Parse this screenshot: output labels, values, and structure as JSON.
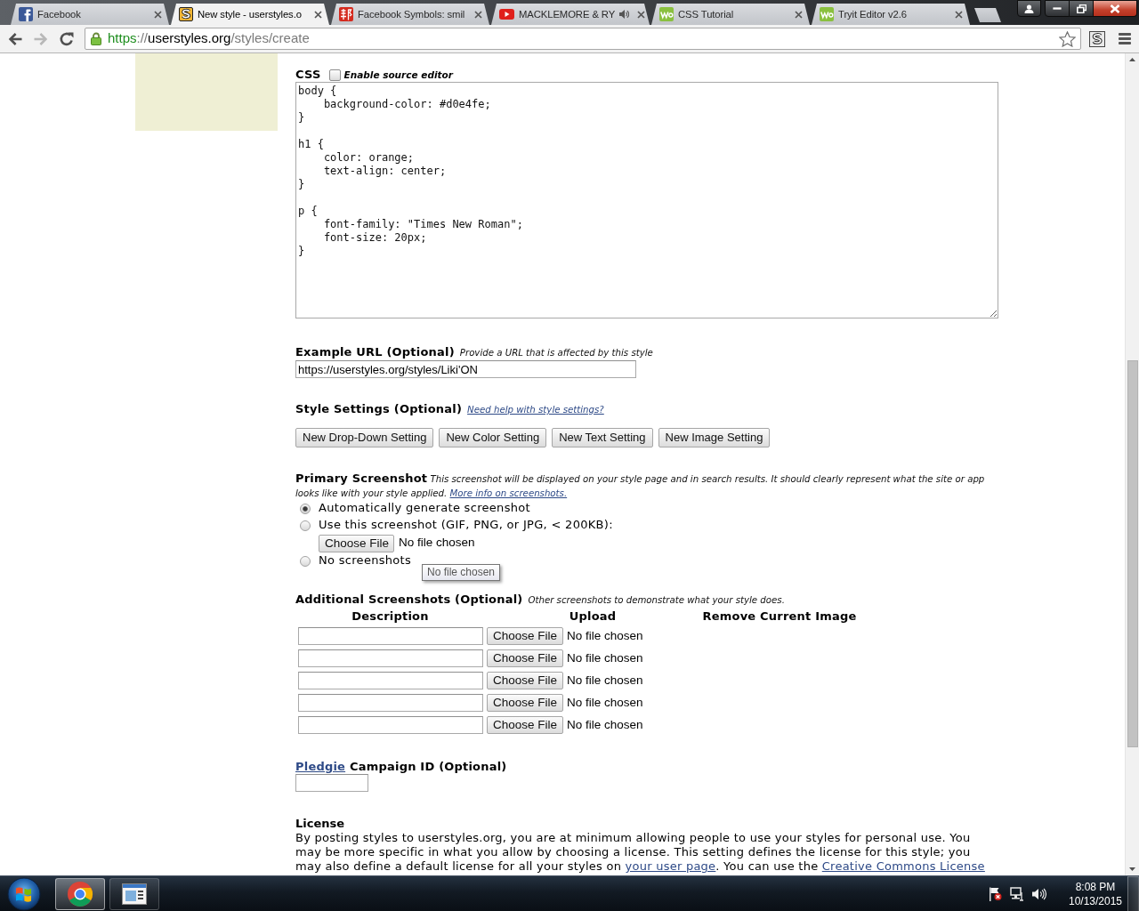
{
  "browser": {
    "tabs": [
      {
        "title": "Facebook",
        "kind": "facebook",
        "audio": false,
        "selected": false
      },
      {
        "title": "New style - userstyles.o",
        "kind": "userstyles",
        "audio": false,
        "selected": true
      },
      {
        "title": "Facebook Symbols: smil",
        "kind": "glyph",
        "audio": false,
        "selected": false
      },
      {
        "title": "MACKLEMORE & RY",
        "kind": "video",
        "audio": true,
        "selected": false
      },
      {
        "title": "CSS Tutorial",
        "kind": "tutorial",
        "audio": false,
        "selected": false
      },
      {
        "title": "Tryit Editor v2.6",
        "kind": "tutorial",
        "audio": false,
        "selected": false
      }
    ],
    "toolbar": {
      "back": {
        "disabled": false
      },
      "forward": {
        "disabled": true
      },
      "address": {
        "secure": true,
        "scheme": "https",
        "separator": "://",
        "host": "userstyles.org",
        "path": "/styles/create"
      },
      "bookmarked": false
    }
  },
  "page": {
    "css": {
      "label": "CSS",
      "source_editor": {
        "label": "Enable source editor",
        "checked": false
      },
      "code": "body {\n    background-color: #d0e4fe;\n}\n\nh1 {\n    color: orange;\n    text-align: center;\n}\n\np {\n    font-family: \"Times New Roman\";\n    font-size: 20px;\n}"
    },
    "example_url": {
      "label": "Example URL (Optional)",
      "hint": "Provide a URL that is affected by this style",
      "value": "https://userstyles.org/styles/Liki'ON"
    },
    "style_settings": {
      "label": "Style Settings (Optional)",
      "help_link": "Need help with style settings?",
      "buttons": [
        "New Drop-Down Setting",
        "New Color Setting",
        "New Text Setting",
        "New Image Setting"
      ]
    },
    "primary_screenshot": {
      "label": "Primary Screenshot",
      "description": "This screenshot will be displayed on your style page and in search results. It should clearly represent what the site or app looks like with your style applied.",
      "info_link": "More info on screenshots.",
      "options": [
        {
          "label": "Automatically generate screenshot",
          "selected": true
        },
        {
          "label": "Use this screenshot (GIF, PNG, or JPG, < 200KB):",
          "selected": false,
          "file": {
            "button": "Choose File",
            "status": "No file chosen"
          }
        },
        {
          "label": "No screenshots",
          "selected": false
        }
      ],
      "tooltip": "No file chosen"
    },
    "additional_screenshots": {
      "label": "Additional Screenshots (Optional)",
      "hint": "Other screenshots to demonstrate what your style does.",
      "columns": [
        "Description",
        "Upload",
        "Remove Current Image"
      ],
      "rows": [
        {
          "button": "Choose File",
          "status": "No file chosen"
        },
        {
          "button": "Choose File",
          "status": "No file chosen"
        },
        {
          "button": "Choose File",
          "status": "No file chosen"
        },
        {
          "button": "Choose File",
          "status": "No file chosen"
        },
        {
          "button": "Choose File",
          "status": "No file chosen"
        }
      ]
    },
    "pledgie": {
      "link": "Pledgie",
      "label": "Campaign ID (Optional)"
    },
    "license": {
      "title": "License",
      "text": [
        {
          "kind": "text",
          "text": "By posting styles to userstyles.org, you are at minimum allowing people to use your styles for personal use. You may be more specific in what you allow by choosing a license. This setting defines the license for this style; you may also define a default license for all your styles on "
        },
        {
          "kind": "link",
          "text": "your user page"
        },
        {
          "kind": "text",
          "text": ". You can use the "
        },
        {
          "kind": "link",
          "text": "Creative Commons License"
        }
      ]
    }
  },
  "taskbar": {
    "apps": [
      {
        "kind": "browser",
        "selected": true
      },
      {
        "kind": "window",
        "selected": false
      }
    ],
    "clock": {
      "time": "8:08 PM",
      "date": "10/13/2015"
    }
  }
}
